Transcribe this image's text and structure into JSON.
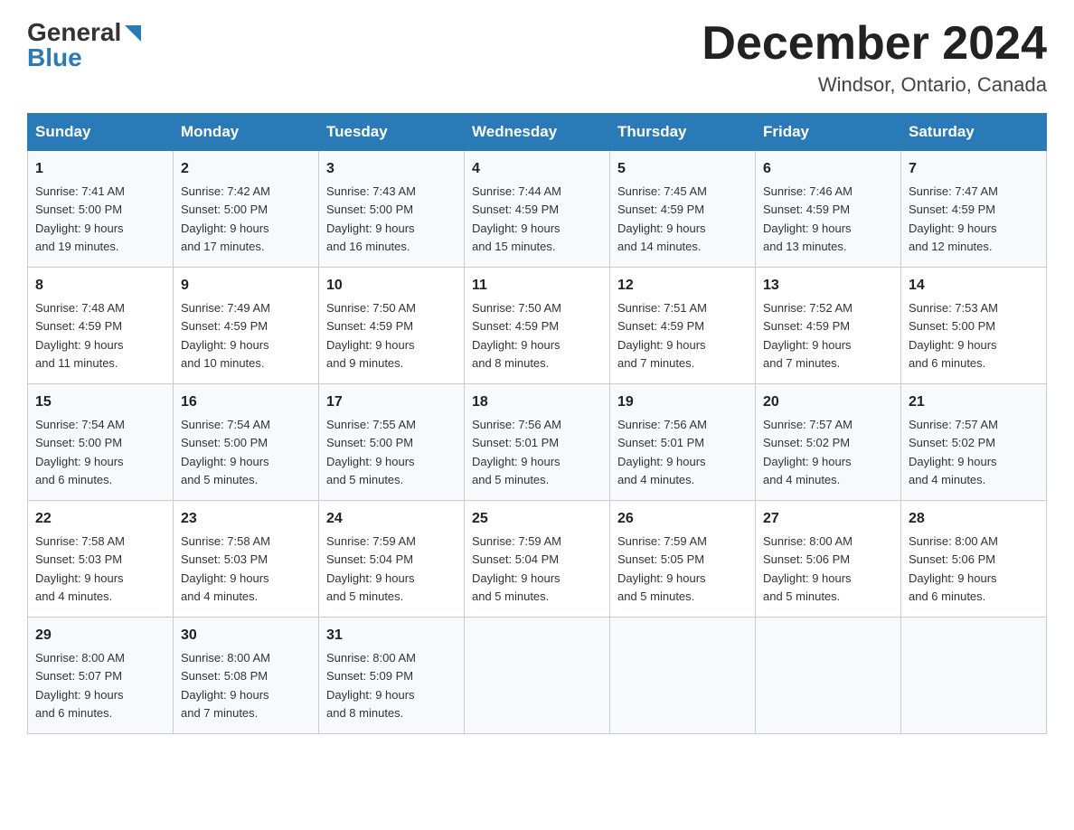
{
  "header": {
    "logo_text_general": "General",
    "logo_text_blue": "Blue",
    "month_year": "December 2024",
    "location": "Windsor, Ontario, Canada"
  },
  "days_of_week": [
    "Sunday",
    "Monday",
    "Tuesday",
    "Wednesday",
    "Thursday",
    "Friday",
    "Saturday"
  ],
  "weeks": [
    [
      {
        "day": "1",
        "sunrise": "7:41 AM",
        "sunset": "5:00 PM",
        "daylight": "9 hours and 19 minutes."
      },
      {
        "day": "2",
        "sunrise": "7:42 AM",
        "sunset": "5:00 PM",
        "daylight": "9 hours and 17 minutes."
      },
      {
        "day": "3",
        "sunrise": "7:43 AM",
        "sunset": "5:00 PM",
        "daylight": "9 hours and 16 minutes."
      },
      {
        "day": "4",
        "sunrise": "7:44 AM",
        "sunset": "4:59 PM",
        "daylight": "9 hours and 15 minutes."
      },
      {
        "day": "5",
        "sunrise": "7:45 AM",
        "sunset": "4:59 PM",
        "daylight": "9 hours and 14 minutes."
      },
      {
        "day": "6",
        "sunrise": "7:46 AM",
        "sunset": "4:59 PM",
        "daylight": "9 hours and 13 minutes."
      },
      {
        "day": "7",
        "sunrise": "7:47 AM",
        "sunset": "4:59 PM",
        "daylight": "9 hours and 12 minutes."
      }
    ],
    [
      {
        "day": "8",
        "sunrise": "7:48 AM",
        "sunset": "4:59 PM",
        "daylight": "9 hours and 11 minutes."
      },
      {
        "day": "9",
        "sunrise": "7:49 AM",
        "sunset": "4:59 PM",
        "daylight": "9 hours and 10 minutes."
      },
      {
        "day": "10",
        "sunrise": "7:50 AM",
        "sunset": "4:59 PM",
        "daylight": "9 hours and 9 minutes."
      },
      {
        "day": "11",
        "sunrise": "7:50 AM",
        "sunset": "4:59 PM",
        "daylight": "9 hours and 8 minutes."
      },
      {
        "day": "12",
        "sunrise": "7:51 AM",
        "sunset": "4:59 PM",
        "daylight": "9 hours and 7 minutes."
      },
      {
        "day": "13",
        "sunrise": "7:52 AM",
        "sunset": "4:59 PM",
        "daylight": "9 hours and 7 minutes."
      },
      {
        "day": "14",
        "sunrise": "7:53 AM",
        "sunset": "5:00 PM",
        "daylight": "9 hours and 6 minutes."
      }
    ],
    [
      {
        "day": "15",
        "sunrise": "7:54 AM",
        "sunset": "5:00 PM",
        "daylight": "9 hours and 6 minutes."
      },
      {
        "day": "16",
        "sunrise": "7:54 AM",
        "sunset": "5:00 PM",
        "daylight": "9 hours and 5 minutes."
      },
      {
        "day": "17",
        "sunrise": "7:55 AM",
        "sunset": "5:00 PM",
        "daylight": "9 hours and 5 minutes."
      },
      {
        "day": "18",
        "sunrise": "7:56 AM",
        "sunset": "5:01 PM",
        "daylight": "9 hours and 5 minutes."
      },
      {
        "day": "19",
        "sunrise": "7:56 AM",
        "sunset": "5:01 PM",
        "daylight": "9 hours and 4 minutes."
      },
      {
        "day": "20",
        "sunrise": "7:57 AM",
        "sunset": "5:02 PM",
        "daylight": "9 hours and 4 minutes."
      },
      {
        "day": "21",
        "sunrise": "7:57 AM",
        "sunset": "5:02 PM",
        "daylight": "9 hours and 4 minutes."
      }
    ],
    [
      {
        "day": "22",
        "sunrise": "7:58 AM",
        "sunset": "5:03 PM",
        "daylight": "9 hours and 4 minutes."
      },
      {
        "day": "23",
        "sunrise": "7:58 AM",
        "sunset": "5:03 PM",
        "daylight": "9 hours and 4 minutes."
      },
      {
        "day": "24",
        "sunrise": "7:59 AM",
        "sunset": "5:04 PM",
        "daylight": "9 hours and 5 minutes."
      },
      {
        "day": "25",
        "sunrise": "7:59 AM",
        "sunset": "5:04 PM",
        "daylight": "9 hours and 5 minutes."
      },
      {
        "day": "26",
        "sunrise": "7:59 AM",
        "sunset": "5:05 PM",
        "daylight": "9 hours and 5 minutes."
      },
      {
        "day": "27",
        "sunrise": "8:00 AM",
        "sunset": "5:06 PM",
        "daylight": "9 hours and 5 minutes."
      },
      {
        "day": "28",
        "sunrise": "8:00 AM",
        "sunset": "5:06 PM",
        "daylight": "9 hours and 6 minutes."
      }
    ],
    [
      {
        "day": "29",
        "sunrise": "8:00 AM",
        "sunset": "5:07 PM",
        "daylight": "9 hours and 6 minutes."
      },
      {
        "day": "30",
        "sunrise": "8:00 AM",
        "sunset": "5:08 PM",
        "daylight": "9 hours and 7 minutes."
      },
      {
        "day": "31",
        "sunrise": "8:00 AM",
        "sunset": "5:09 PM",
        "daylight": "9 hours and 8 minutes."
      },
      null,
      null,
      null,
      null
    ]
  ],
  "labels": {
    "sunrise": "Sunrise:",
    "sunset": "Sunset:",
    "daylight": "Daylight:"
  }
}
